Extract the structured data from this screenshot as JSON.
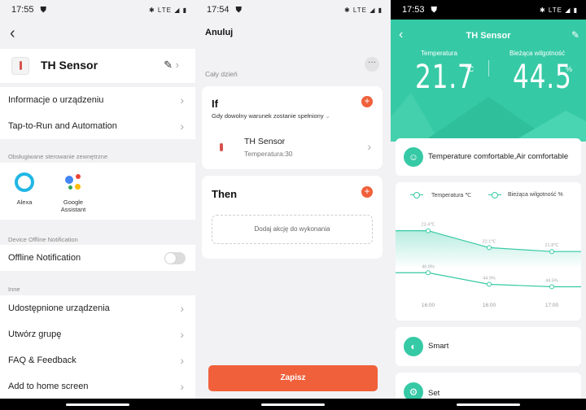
{
  "colors": {
    "accent_orange": "#f0603a",
    "teal": "#36c9a5",
    "bg": "#f2f2f4"
  },
  "panel1": {
    "status": {
      "time": "17:55",
      "icons": "✱ LTE ◢ ▮"
    },
    "device_name": "TH Sensor",
    "rows_top": [
      {
        "label": "Informacje o urządzeniu"
      },
      {
        "label": "Tap-to-Run and Automation"
      }
    ],
    "ext_section_title": "Obsługiwane sterowanie zewnętrzne",
    "services": [
      {
        "label": "Alexa"
      },
      {
        "label": "Google Assistant"
      }
    ],
    "offline_section_title": "Device Offline Notification",
    "offline_label": "Offline Notification",
    "other_section_title": "Inne",
    "rows_other": [
      {
        "label": "Udostępnione urządzenia"
      },
      {
        "label": "Utwórz grupę"
      },
      {
        "label": "FAQ & Feedback"
      },
      {
        "label": "Add to home screen"
      }
    ]
  },
  "panel2": {
    "status": {
      "time": "17:54",
      "icons": "✱ LTE ◢ ▮"
    },
    "cancel": "Anuluj",
    "all_day": "Cały dzień",
    "if_title": "If",
    "if_condition": "Gdy dowolny warunek zostanie spełniony",
    "condition_device": "TH Sensor",
    "condition_detail": "Temperatura:30",
    "then_title": "Then",
    "add_action": "Dodaj akcję do wykonania",
    "save": "Zapisz"
  },
  "panel3": {
    "status": {
      "time": "17:53",
      "icons": "✱ LTE ◢ ▮"
    },
    "title": "TH Sensor",
    "temp_label": "Temperatura",
    "temp_value": "21.7",
    "temp_unit": "°C",
    "hum_label": "Bieżąca wilgotność",
    "hum_value": "44.5",
    "hum_unit": "%",
    "comfort": "Temperature comfortable,Air comfortable",
    "legend_temp": "Temperatura ℃",
    "legend_hum": "Bieżąca wilgotność %",
    "smart": "Smart",
    "set": "Set"
  },
  "chart_data": {
    "type": "line",
    "categories": [
      "16:00",
      "16:00",
      "17:00"
    ],
    "series": [
      {
        "name": "Temperatura ℃",
        "values": [
          23.4,
          22.1,
          21.8
        ],
        "labels": [
          "23.4℃",
          "22.1℃",
          "21.8℃"
        ]
      },
      {
        "name": "Bieżąca wilgotność %",
        "values": [
          46.8,
          44.9,
          44.5
        ],
        "labels": [
          "46.8%",
          "44.9%",
          "44.5%"
        ]
      }
    ]
  }
}
